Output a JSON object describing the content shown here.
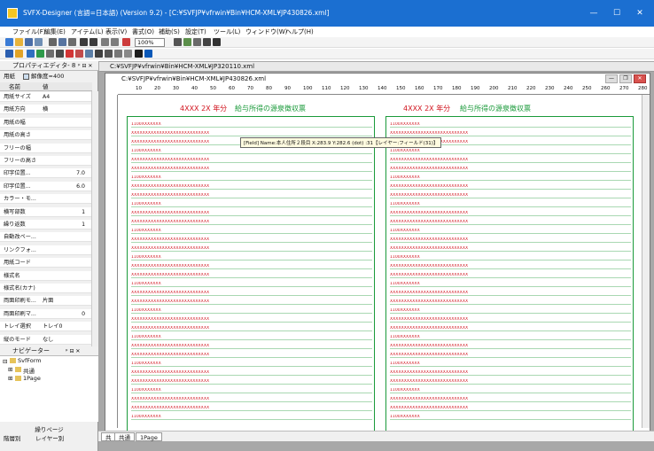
{
  "window": {
    "title": "SVFX-Designer (言語=日本語) (Version 9.2) - [C:¥SVFJP¥vfrwin¥Bin¥HCM-XML¥JP430826.xml]",
    "minimize": "—",
    "maximize": "☐",
    "close": "✕"
  },
  "menubar": [
    "ファイル(F)",
    "編集(E)",
    "アイテム(L)",
    "表示(V)",
    "書式(O)",
    "補助(S)",
    "設定(T)",
    "ツール(L)",
    "ウィンドウ(W)",
    "ヘルプ(H)"
  ],
  "toolbar": {
    "zoom": "100%"
  },
  "property_pane": {
    "title": "プロパティエディタ- 8",
    "pin": "ᵖ ⊟ ✕",
    "filter_label": "用紙",
    "resolution_label": "解像度=400",
    "col_name": "名前",
    "col_value": "値",
    "rows": [
      {
        "k": "用紙サイズ",
        "v": "A4",
        "n": ""
      },
      {
        "k": "用紙方向",
        "v": "横",
        "n": ""
      },
      {
        "k": "用紙の幅",
        "v": "",
        "n": ""
      },
      {
        "k": "用紙の高さ",
        "v": "",
        "n": ""
      },
      {
        "k": "フリーの幅",
        "v": "",
        "n": ""
      },
      {
        "k": "フリーの高さ",
        "v": "",
        "n": ""
      },
      {
        "k": "印字位置...",
        "v": "",
        "n": "7.0"
      },
      {
        "k": "印字位置...",
        "v": "",
        "n": "6.0"
      },
      {
        "k": "カラー・モ...",
        "v": "",
        "n": ""
      },
      {
        "k": "横写部数",
        "v": "",
        "n": "1"
      },
      {
        "k": "繰り返数",
        "v": "",
        "n": "1"
      },
      {
        "k": "自動改ペー...",
        "v": "",
        "n": ""
      },
      {
        "k": "リンクフォ...",
        "v": "",
        "n": ""
      },
      {
        "k": "用紙コード",
        "v": "",
        "n": ""
      },
      {
        "k": "様式名",
        "v": "",
        "n": ""
      },
      {
        "k": "様式名(カナ)",
        "v": "",
        "n": ""
      },
      {
        "k": "両面印刷モ...",
        "v": "片面",
        "n": ""
      },
      {
        "k": "両面印刷マ...",
        "v": "",
        "n": "0"
      },
      {
        "k": "トレイ選択",
        "v": "トレイ0",
        "n": ""
      },
      {
        "k": "縦のモード",
        "v": "なし",
        "n": ""
      }
    ]
  },
  "navigator": {
    "title": "ナビゲーター",
    "pin": "ᵖ ⊟ ✕",
    "root": "SvfForm",
    "child1": "共通",
    "child2": "1Page",
    "footer": "繰りページ",
    "tab_pages": "階層別",
    "tab_layers": "レイヤー別"
  },
  "documents": {
    "back_title": "C:¥SVFJP¥vfrwin¥Bin¥HCM-XML¥JP320110.xml",
    "front_title": "C:¥SVFJP¥vfrwin¥Bin¥HCM-XML¥JP430826.xml",
    "ruler_marks": [
      "10",
      "20",
      "30",
      "40",
      "50",
      "60",
      "70",
      "80",
      "90",
      "100",
      "110",
      "120",
      "130",
      "140",
      "150",
      "160",
      "170",
      "180",
      "190",
      "200",
      "210",
      "220",
      "230",
      "240",
      "250",
      "260",
      "270",
      "280"
    ]
  },
  "form": {
    "year_label": "4XXX  2X 年分",
    "title": "給与所得の源泉徴収票",
    "tooltip": "[Field] Name:本人住所２段目 X:283.9 Y:282.6 (dot) :31【レイヤー:フィールド(31)】",
    "amount": "1100XXXXXXX",
    "xxx": "XXXXXXXXXXXXXXXXXXXXXXXXXXXX"
  },
  "bottom_tabs": [
    "共",
    "共通",
    "1Page"
  ]
}
